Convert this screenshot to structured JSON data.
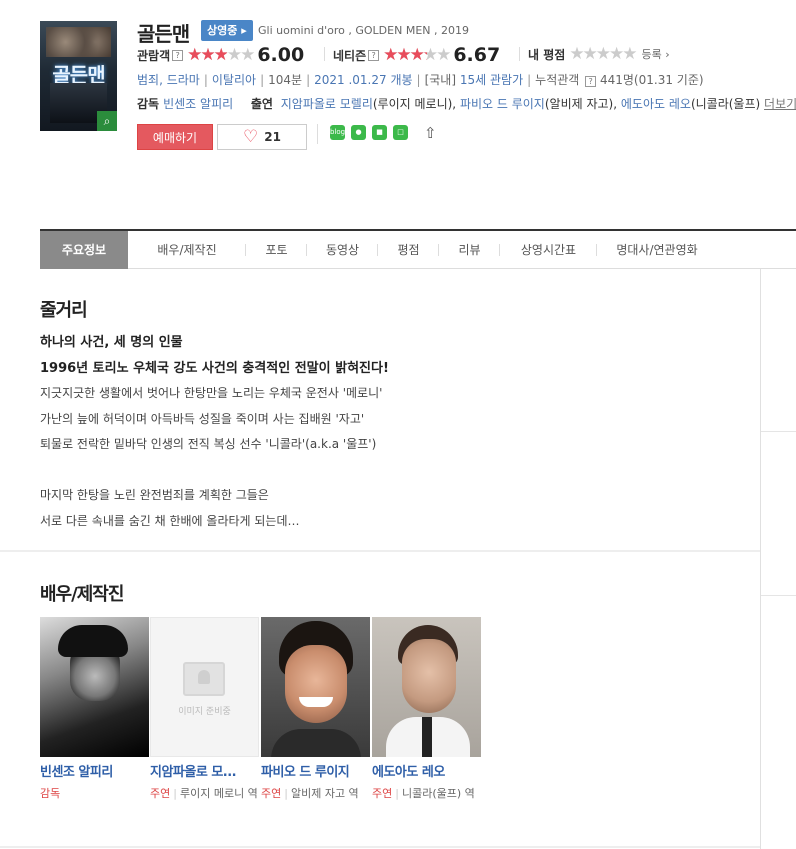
{
  "movie": {
    "title": "골든맨",
    "status_badge": "상영중",
    "original": "Gli uomini d'oro , GOLDEN MEN , 2019",
    "poster_text": "골든맨",
    "ratings": [
      {
        "label": "관람객",
        "score": "6.00",
        "fraction": 0.6
      },
      {
        "label": "네티즌",
        "score": "6.67",
        "fraction": 0.667
      },
      {
        "label": "내 평점",
        "fraction": 0,
        "register": "등록"
      }
    ],
    "info": {
      "genre": "범죄, 드라마",
      "country": "이탈리아",
      "runtime": "104분",
      "release": "2021 .01.27 개봉",
      "grade_prefix": "[국내]",
      "grade": "15세 관람가",
      "audience_label": "누적관객",
      "audience": "441명(01.31 기준)"
    },
    "crew": {
      "director_label": "감독",
      "director": "빈센조 알피리",
      "cast_label": "출연",
      "cast_1": "지암파올로 모렐리",
      "cast_1_role": "(루이지 메로니),",
      "cast_2": "파비오 드 루이지",
      "cast_2_role": "(알비제 자고),",
      "cast_3": "에도아도 레오",
      "cast_3_role": "(니콜라(울프)",
      "more": "더보기"
    },
    "book_button": "예매하기",
    "like_count": "21"
  },
  "tabs": [
    "주요정보",
    "배우/제작진",
    "포토",
    "동영상",
    "평점",
    "리뷰",
    "상영시간표",
    "명대사/연관영화"
  ],
  "synopsis": {
    "heading": "줄거리",
    "lines_bold": [
      "하나의 사건, 세 명의 인물",
      "1996년 토리노 우체국 강도 사건의 충격적인 전말이 밝혀진다!"
    ],
    "lines": [
      "지긋지긋한 생활에서 벗어나 한탕만을 노리는 우체국 운전사 '메로니'",
      " 가난의 늪에 허덕이며 아득바득 성질을 죽이며 사는 집배원 '자고'",
      " 퇴물로 전락한 밑바닥 인생의 전직 복싱 선수 '니콜라'(a.k.a '울프')",
      "",
      " 마지막 한탕을 노린 완전범죄를 계획한 그들은",
      " 서로 다른 속내를 숨긴 채 한배에 올라타게 되는데…"
    ]
  },
  "cast_section": {
    "heading": "배우/제작진",
    "no_image": "이미지 준비중",
    "people": [
      {
        "name": "빈센조 알피리",
        "type": "감독",
        "role": ""
      },
      {
        "name": "지암파올로 모...",
        "type": "주연",
        "role": "루이지 메로니 역"
      },
      {
        "name": "파비오 드 루이지",
        "type": "주연",
        "role": "알비제 자고 역"
      },
      {
        "name": "에도아도 레오",
        "type": "주연",
        "role": "니콜라(울프) 역"
      }
    ]
  }
}
